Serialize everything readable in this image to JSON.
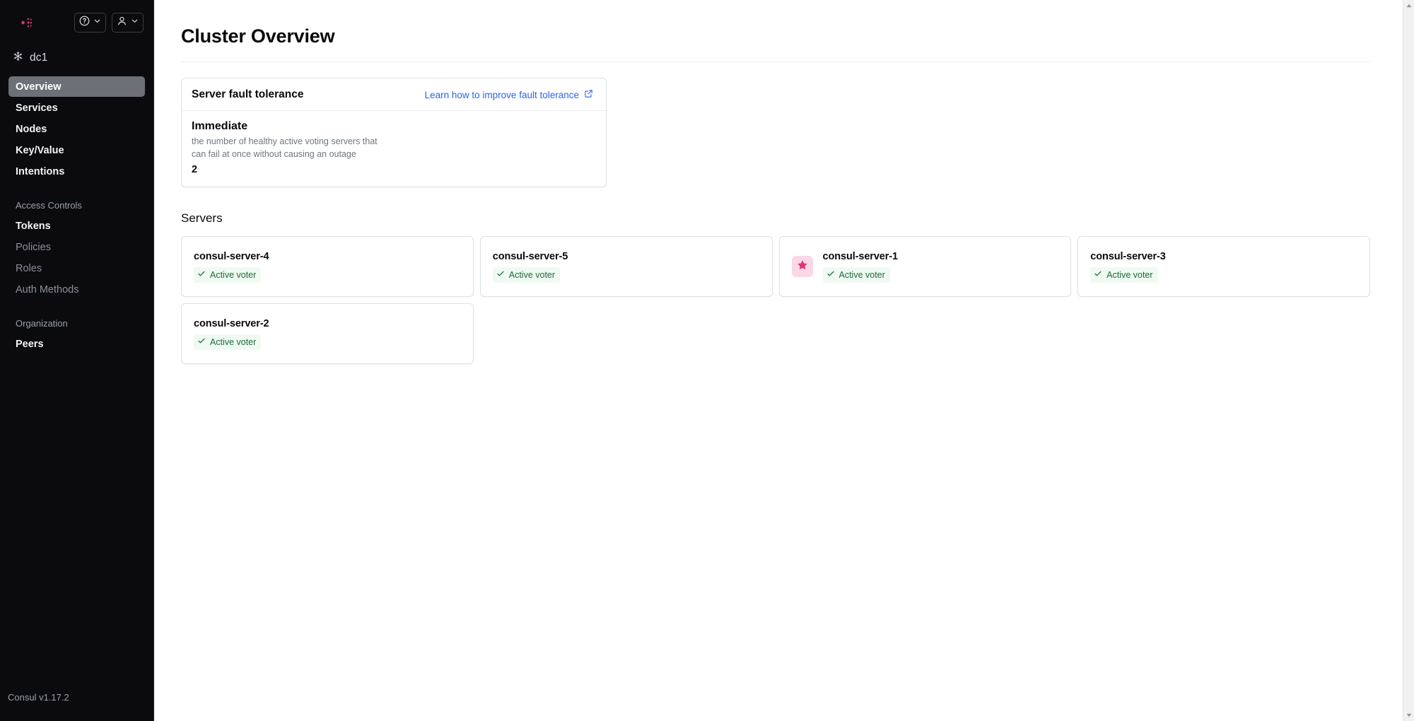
{
  "app": {
    "brand": "consul-logo",
    "version_label": "Consul v1.17.2",
    "accent_color": "#e0367a",
    "link_color": "#2a63ea",
    "active_nav_bg": "#6e7078",
    "sidebar_bg": "#0b0b0d",
    "leader_badge_bg": "#fbd8e6",
    "status_ok_bg": "#effaf2",
    "status_ok_fg": "#1d6b38"
  },
  "topbar": {
    "help_button": {
      "icon": "help-circle-icon",
      "caret": "chevron-down-icon"
    },
    "user_button": {
      "icon": "user-icon",
      "caret": "chevron-down-icon"
    }
  },
  "datacenter": {
    "icon": "datacenter-snowflake-icon",
    "label": "dc1"
  },
  "sidebar": {
    "primary_items": [
      {
        "label": "Overview",
        "active": true,
        "muted": false
      },
      {
        "label": "Services",
        "active": false,
        "muted": false
      },
      {
        "label": "Nodes",
        "active": false,
        "muted": false
      },
      {
        "label": "Key/Value",
        "active": false,
        "muted": false
      },
      {
        "label": "Intentions",
        "active": false,
        "muted": false
      }
    ],
    "sections": [
      {
        "title": "Access Controls",
        "items": [
          {
            "label": "Tokens",
            "muted": false
          },
          {
            "label": "Policies",
            "muted": true
          },
          {
            "label": "Roles",
            "muted": true
          },
          {
            "label": "Auth Methods",
            "muted": true
          }
        ]
      },
      {
        "title": "Organization",
        "items": [
          {
            "label": "Peers",
            "muted": false
          }
        ]
      }
    ]
  },
  "main": {
    "page_title": "Cluster Overview",
    "fault_tolerance": {
      "title": "Server fault tolerance",
      "link_label": "Learn how to improve fault tolerance",
      "link_icon": "external-link-icon",
      "metric_heading": "Immediate",
      "metric_description": "the number of healthy active voting servers that can fail at once without causing an outage",
      "metric_value": "2"
    },
    "servers_section": {
      "title": "Servers",
      "servers": [
        {
          "name": "consul-server-4",
          "status": "Active voter",
          "leader": false
        },
        {
          "name": "consul-server-5",
          "status": "Active voter",
          "leader": false
        },
        {
          "name": "consul-server-1",
          "status": "Active voter",
          "leader": true
        },
        {
          "name": "consul-server-3",
          "status": "Active voter",
          "leader": false
        },
        {
          "name": "consul-server-2",
          "status": "Active voter",
          "leader": false
        }
      ],
      "leader_icon": "star-icon",
      "status_icon": "check-icon"
    }
  },
  "scrollbar": {
    "up_arrow": "scroll-up-arrow-icon",
    "down_arrow": "scroll-down-arrow-icon"
  }
}
